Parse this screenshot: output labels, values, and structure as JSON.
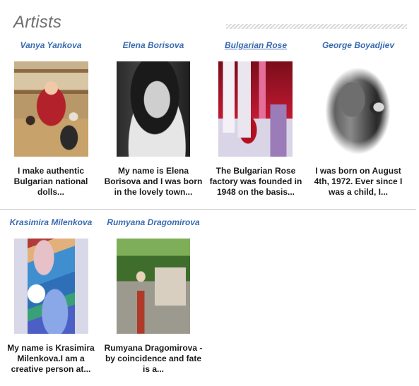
{
  "page": {
    "title": "Artists"
  },
  "artists": [
    {
      "name": "Vanya Yankova",
      "description": "I make authentic Bulgarian national dolls...",
      "photo_icon": "artist-photo-dolls"
    },
    {
      "name": "Elena Borisova",
      "description": "My name is Elena Borisova and I was born in the lovely town...",
      "photo_icon": "artist-photo-portrait"
    },
    {
      "name": "Bulgarian Rose",
      "description": "The Bulgarian Rose factory was founded in 1948 on the basis...",
      "photo_icon": "artist-photo-cosmetics"
    },
    {
      "name": "George Boyadjiev",
      "description": "I was born on August 4th, 1972. Ever since I was a child, I...",
      "photo_icon": "artist-photo-portrait"
    },
    {
      "name": "Krasimira Milenkova",
      "description": "My name is Krasimira Milenkova.I am a creative person at...",
      "photo_icon": "artist-photo-painting"
    },
    {
      "name": "Rumyana Dragomirova",
      "description": "Rumyana Dragomirova - by coincidence and fate is a...",
      "photo_icon": "artist-photo-outdoor"
    }
  ],
  "colors": {
    "link": "#3a6cb0",
    "title": "#6f6f6f",
    "text": "#1b1b1b",
    "divider": "#c9c9c9"
  }
}
